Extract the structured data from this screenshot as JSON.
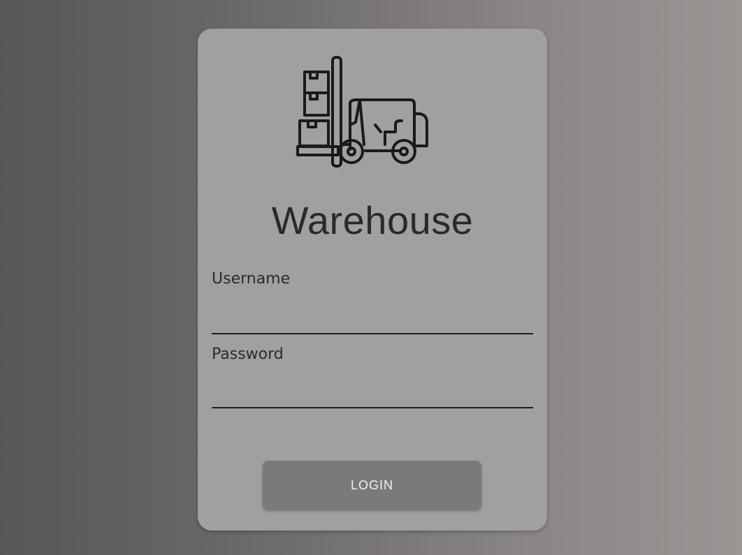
{
  "app": {
    "title": "Warehouse"
  },
  "logo": {
    "icon": "forklift-icon"
  },
  "form": {
    "username": {
      "label": "Username",
      "value": ""
    },
    "password": {
      "label": "Password",
      "value": ""
    },
    "login_label": "LOGIN"
  },
  "colors": {
    "card": "#a0a0a0",
    "button": "#7a7a7a",
    "button_text": "#f2f2f2",
    "text": "#2a2a2a"
  }
}
